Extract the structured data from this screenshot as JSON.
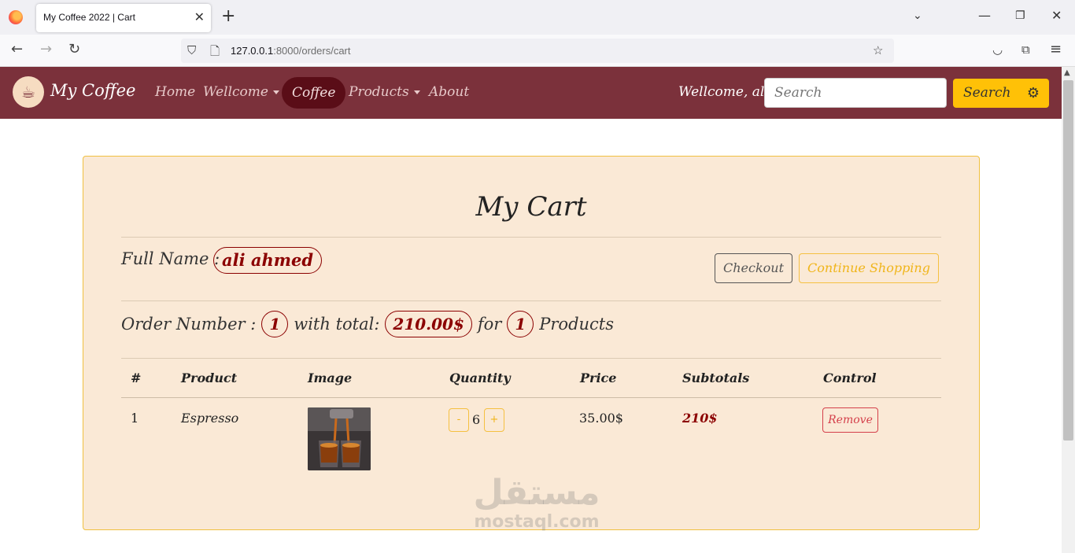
{
  "browser": {
    "tab_title": "My Coffee 2022 | Cart",
    "url_host": "127.0.0.1",
    "url_rest": ":8000/orders/cart"
  },
  "site": {
    "brand": "My Coffee",
    "nav": {
      "home": "Home",
      "wellcome": "Wellcome",
      "coffee": "Coffee",
      "products": "Products",
      "about": "About"
    },
    "welcome_text": "Wellcome, ali",
    "search_placeholder": "Search",
    "search_button": "Search"
  },
  "cart": {
    "title": "My Cart",
    "full_name_label": "Full Name :",
    "full_name": "ali ahmed",
    "checkout_label": "Checkout",
    "continue_label": "Continue Shopping",
    "order_number_label": "Order Number :",
    "order_number": "1",
    "with_total_label": "with total:",
    "total": "210.00$",
    "for_label": "for",
    "product_count": "1",
    "products_label": "Products",
    "columns": [
      "#",
      "Product",
      "Image",
      "Quantity",
      "Price",
      "Subtotals",
      "Control"
    ],
    "rows": [
      {
        "index": "1",
        "product": "Espresso",
        "image_icon": "espresso-cups-image",
        "qty_minus": "-",
        "quantity": "6",
        "qty_plus": "+",
        "price": "35.00$",
        "subtotal": "210$",
        "remove_label": "Remove"
      }
    ]
  },
  "watermark": {
    "arabic": "مستقل",
    "latin": "mostaql.com"
  },
  "colors": {
    "navbar": "#7b313b",
    "card_bg": "#fae9d6",
    "accent": "#ffc107",
    "dark_red": "#8b0000"
  }
}
